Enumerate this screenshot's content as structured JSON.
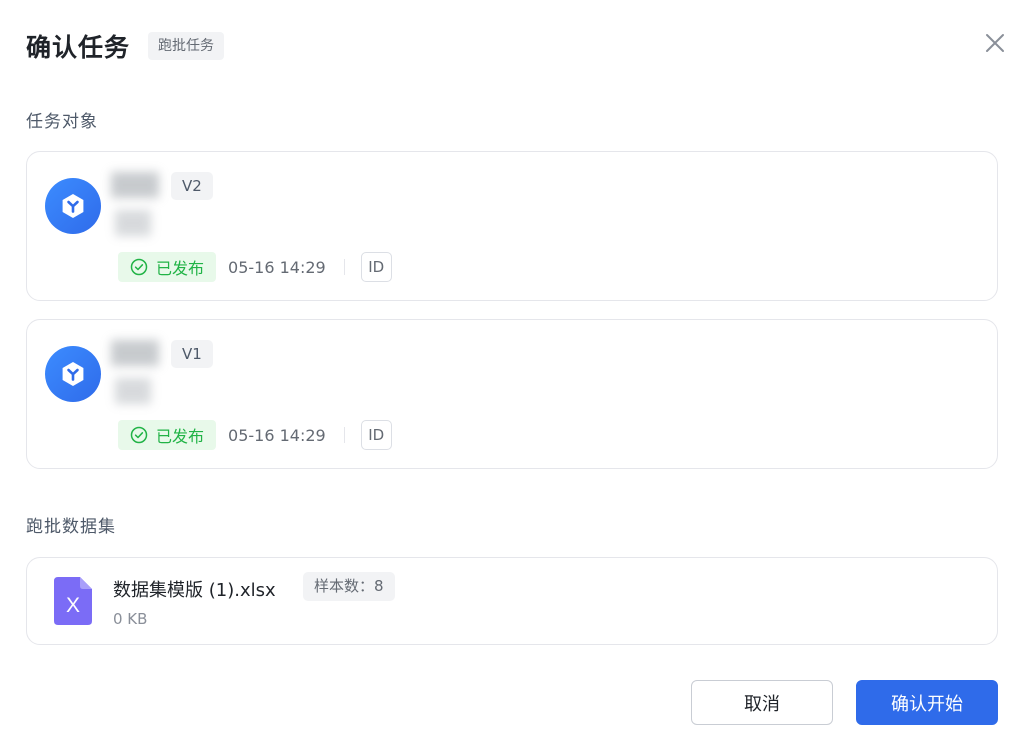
{
  "dialog": {
    "title": "确认任务",
    "title_tag": "跑批任务"
  },
  "sections": {
    "target_label": "任务对象",
    "dataset_label": "跑批数据集"
  },
  "targets": [
    {
      "version": "V2",
      "status": "已发布",
      "time": "05-16 14:29",
      "id_label": "ID"
    },
    {
      "version": "V1",
      "status": "已发布",
      "time": "05-16 14:29",
      "id_label": "ID"
    }
  ],
  "dataset": {
    "file_name": "数据集模版 (1).xlsx",
    "sample_count": "样本数：8",
    "file_size": "0 KB",
    "file_icon_letter": "X"
  },
  "footer": {
    "cancel_label": "取消",
    "confirm_label": "确认开始"
  },
  "colors": {
    "primary": "#2f6bea",
    "success": "#21b346",
    "success_bg": "#e8f9ea",
    "excel_icon": "#7b6cf6"
  },
  "icons": {
    "close": "close-icon",
    "app_logo": "app-logo-icon",
    "status": "check-circle-icon",
    "file": "excel-file-icon"
  }
}
